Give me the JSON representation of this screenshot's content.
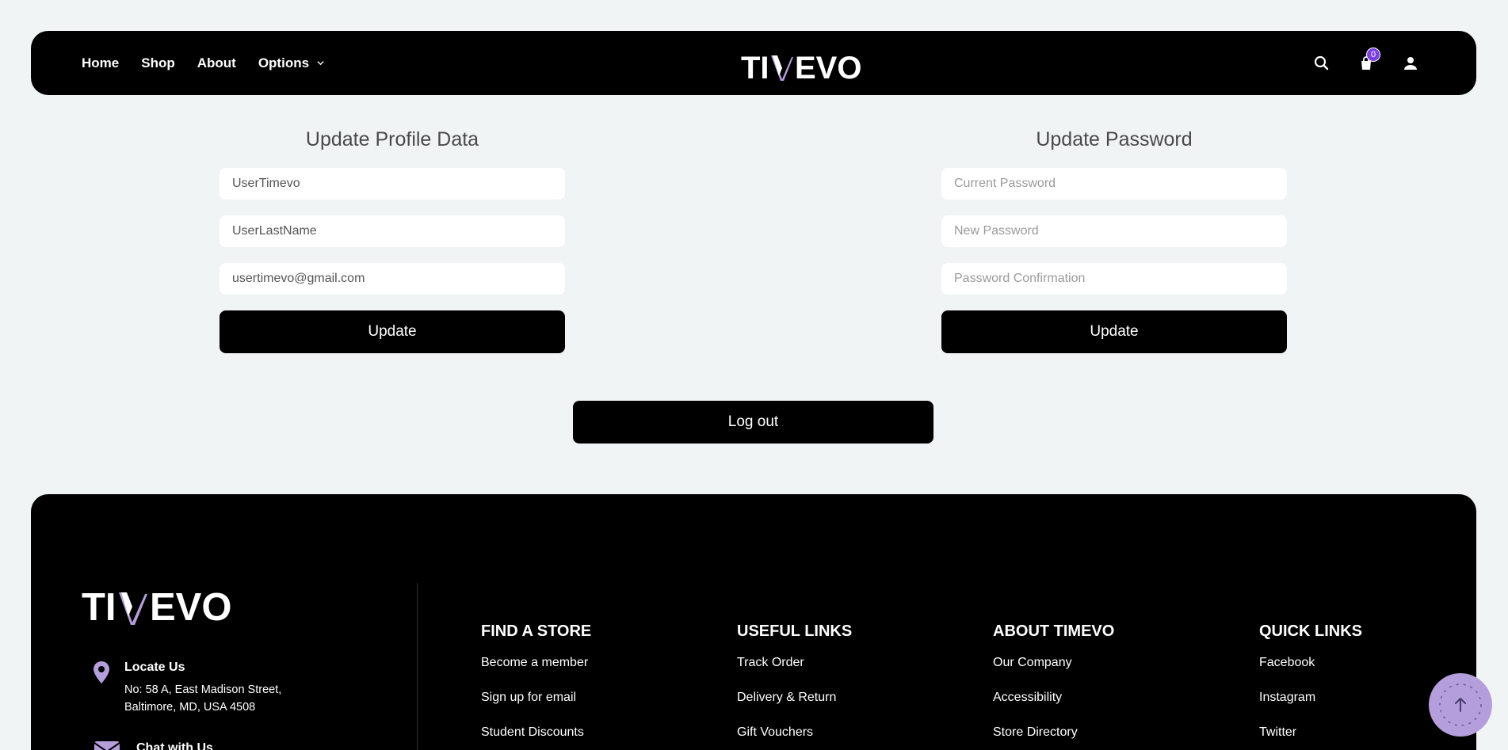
{
  "header": {
    "nav": [
      {
        "label": "Home"
      },
      {
        "label": "Shop"
      },
      {
        "label": "About"
      },
      {
        "label": "Options"
      }
    ],
    "logo_text": "TIMEVO",
    "cart_count": "0",
    "icons": [
      "search-icon",
      "cart-icon",
      "user-icon"
    ]
  },
  "profile_form": {
    "title": "Update Profile Data",
    "first_name": "UserTimevo",
    "last_name": "UserLastName",
    "email": "usertimevo@gmail.com",
    "button": "Update"
  },
  "password_form": {
    "title": "Update Password",
    "current_placeholder": "Current Password",
    "new_placeholder": "New Password",
    "confirm_placeholder": "Password Confirmation",
    "button": "Update"
  },
  "logout_label": "Log out",
  "footer": {
    "logo_text": "TIMEVO",
    "locate": {
      "title": "Locate Us",
      "line1": "No: 58 A, East Madison Street,",
      "line2": "Baltimore, MD, USA 4508"
    },
    "chat": {
      "title": "Chat with Us"
    },
    "columns": [
      {
        "heading": "FIND A STORE",
        "links": [
          "Become a member",
          "Sign up for email",
          "Student Discounts"
        ]
      },
      {
        "heading": "USEFUL LINKS",
        "links": [
          "Track Order",
          "Delivery & Return",
          "Gift Vouchers"
        ]
      },
      {
        "heading": "ABOUT TIMEVO",
        "links": [
          "Our Company",
          "Accessibility",
          "Store Directory"
        ]
      },
      {
        "heading": "QUICK LINKS",
        "links": [
          "Facebook",
          "Instagram",
          "Twitter"
        ]
      }
    ]
  },
  "colors": {
    "background": "#f0f4f5",
    "dark": "#000000",
    "accent": "#b49fdc",
    "badge": "#7b3fe4"
  }
}
